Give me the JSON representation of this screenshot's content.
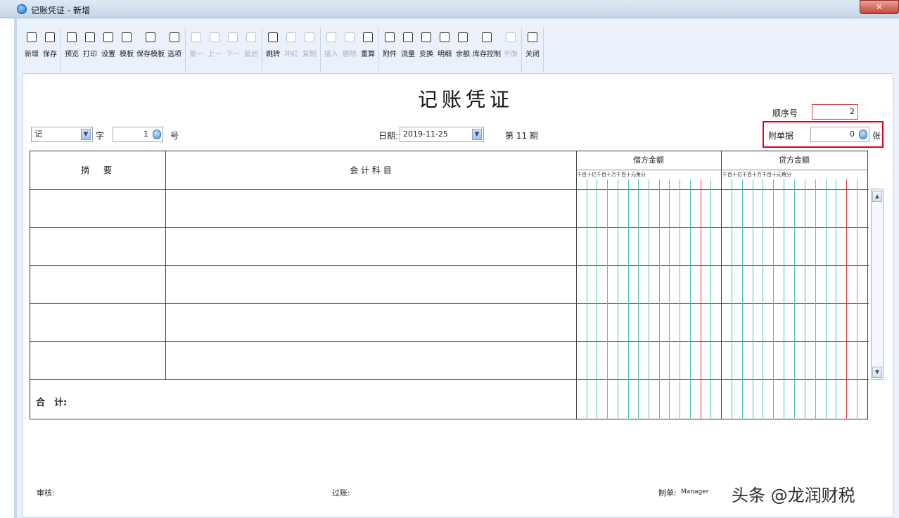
{
  "window": {
    "title": "记账凭证 - 新增",
    "close_label": "✕"
  },
  "toolbar": {
    "groups": [
      [
        {
          "label": "新增",
          "enabled": true
        },
        {
          "label": "保存",
          "enabled": true
        }
      ],
      [
        {
          "label": "预览",
          "enabled": true
        },
        {
          "label": "打印",
          "enabled": true
        },
        {
          "label": "设置",
          "enabled": true
        },
        {
          "label": "模板",
          "enabled": true
        },
        {
          "label": "保存模板",
          "enabled": true
        },
        {
          "label": "选项",
          "enabled": true
        }
      ],
      [
        {
          "label": "第一",
          "enabled": false
        },
        {
          "label": "上一",
          "enabled": false
        },
        {
          "label": "下一",
          "enabled": false
        },
        {
          "label": "最后",
          "enabled": false
        }
      ],
      [
        {
          "label": "跳转",
          "enabled": true
        },
        {
          "label": "冲红",
          "enabled": false
        },
        {
          "label": "复制",
          "enabled": false
        }
      ],
      [
        {
          "label": "插入",
          "enabled": false
        },
        {
          "label": "删除",
          "enabled": false
        },
        {
          "label": "重算",
          "enabled": true
        }
      ],
      [
        {
          "label": "附件",
          "enabled": true
        },
        {
          "label": "流量",
          "enabled": true
        },
        {
          "label": "变换",
          "enabled": true
        },
        {
          "label": "明细",
          "enabled": true
        },
        {
          "label": "余额",
          "enabled": true
        },
        {
          "label": "库存控制",
          "enabled": true
        },
        {
          "label": "平衡",
          "enabled": false
        }
      ],
      [
        {
          "label": "关闭",
          "enabled": true
        }
      ]
    ]
  },
  "voucher": {
    "title": "记账凭证",
    "type_value": "记",
    "zi_label": "字",
    "number_value": "1",
    "hao_label": "号",
    "date_label": "日期:",
    "date_value": "2019-11-25",
    "period_text": "第 11 期",
    "seq_label": "顺序号",
    "seq_value": "2",
    "attach_label": "附单据",
    "attach_value": "0",
    "attach_suffix": "张"
  },
  "table": {
    "col_summary": "摘　要",
    "col_account": "会 计 科 目",
    "col_debit": "借方金额",
    "col_credit": "贷方金额",
    "digit_header": "千百十亿千百十万千百十元角分",
    "total_label": "合　计:"
  },
  "footer": {
    "reviewer_label": "审核:",
    "poster_label": "过账:",
    "maker_label": "制单:",
    "maker_value": "Manager"
  },
  "watermark": "头条 @龙润财税"
}
